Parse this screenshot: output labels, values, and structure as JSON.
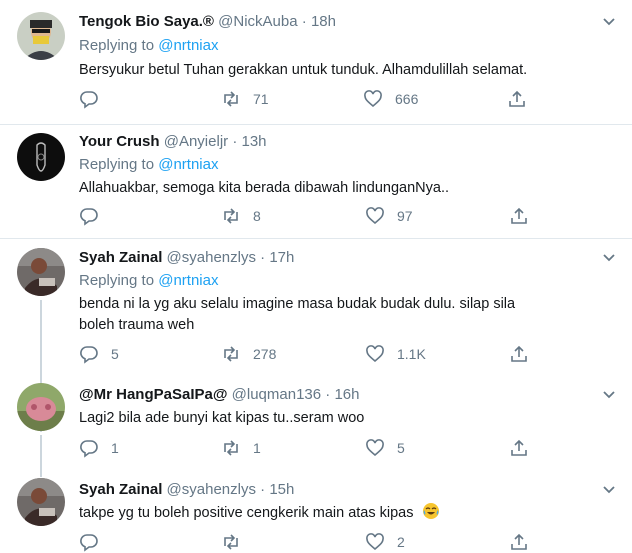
{
  "colors": {
    "link": "#1da1f2",
    "secondary": "#657786",
    "divider": "#e1e8ed",
    "thread": "#ccd6dd"
  },
  "tweets": [
    {
      "name": "Tengok Bio Saya.®",
      "handle": "@NickAuba",
      "time": "18h",
      "replying_prefix": "Replying to",
      "replying_to": "@nrtniax",
      "text": "Bersyukur betul Tuhan gerakkan untuk tunduk. Alhamdulillah selamat.",
      "replies": "",
      "retweets": "71",
      "likes": "666"
    },
    {
      "name": "Your Crush",
      "handle": "@Anyieljr",
      "time": "13h",
      "replying_prefix": "Replying to",
      "replying_to": "@nrtniax",
      "text": "Allahuakbar, semoga kita berada dibawah lindunganNya..",
      "replies": "",
      "retweets": "8",
      "likes": "97"
    },
    {
      "name": "Syah Zainal",
      "handle": "@syahenzlys",
      "time": "17h",
      "replying_prefix": "Replying to",
      "replying_to": "@nrtniax",
      "text": "benda ni la yg aku selalu imagine masa budak budak dulu. silap sila boleh trauma weh",
      "replies": "5",
      "retweets": "278",
      "likes": "1.1K"
    },
    {
      "name": "@Mr HangPaSaIPa@",
      "handle": "@luqman136",
      "time": "16h",
      "text": "Lagi2 bila ade bunyi kat kipas tu..seram woo",
      "replies": "1",
      "retweets": "1",
      "likes": "5"
    },
    {
      "name": "Syah Zainal",
      "handle": "@syahenzlys",
      "time": "15h",
      "text": "takpe yg tu boleh positive cengkerik main atas kipas",
      "replies": "",
      "retweets": "",
      "likes": "2"
    }
  ],
  "icons": {
    "reply": "reply-icon",
    "retweet": "retweet-icon",
    "like": "heart-icon",
    "share": "share-icon",
    "caret": "chevron-down-icon",
    "emoji": "tears-of-joy-emoji"
  }
}
